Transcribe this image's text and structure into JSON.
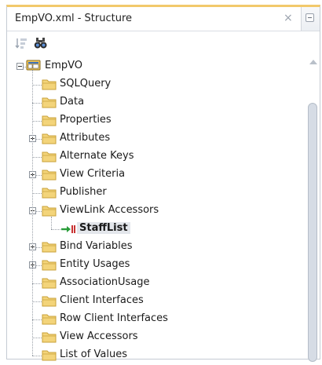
{
  "window": {
    "tab_title": "EmpVO.xml - Structure",
    "close_glyph": "×"
  },
  "toolbar": {
    "sort_icon": "sort-icon",
    "find_icon": "binoculars-icon"
  },
  "tree": {
    "root": {
      "label": "EmpVO",
      "icon": "view-object-icon",
      "expanded": true
    },
    "nodes": [
      {
        "label": "SQLQuery",
        "expander": "none"
      },
      {
        "label": "Data",
        "expander": "none"
      },
      {
        "label": "Properties",
        "expander": "none"
      },
      {
        "label": "Attributes",
        "expander": "plus"
      },
      {
        "label": "Alternate Keys",
        "expander": "none"
      },
      {
        "label": "View Criteria",
        "expander": "plus"
      },
      {
        "label": "Publisher",
        "expander": "none"
      },
      {
        "label": "ViewLink Accessors",
        "expander": "minus"
      },
      {
        "label": "Bind Variables",
        "expander": "plus"
      },
      {
        "label": "Entity Usages",
        "expander": "plus"
      },
      {
        "label": "AssociationUsage",
        "expander": "none"
      },
      {
        "label": "Client Interfaces",
        "expander": "none"
      },
      {
        "label": "Row Client Interfaces",
        "expander": "none"
      },
      {
        "label": "View Accessors",
        "expander": "none"
      },
      {
        "label": "List of Values",
        "expander": "none"
      }
    ],
    "child": {
      "label": "StaffList",
      "icon": "viewlink-accessor-icon",
      "selected": true
    }
  },
  "colors": {
    "folder_fill": "#f3d47a",
    "folder_edge": "#c9a23a",
    "tab_accent": "#f2c96b",
    "selection_bg": "#e3e6eb"
  }
}
